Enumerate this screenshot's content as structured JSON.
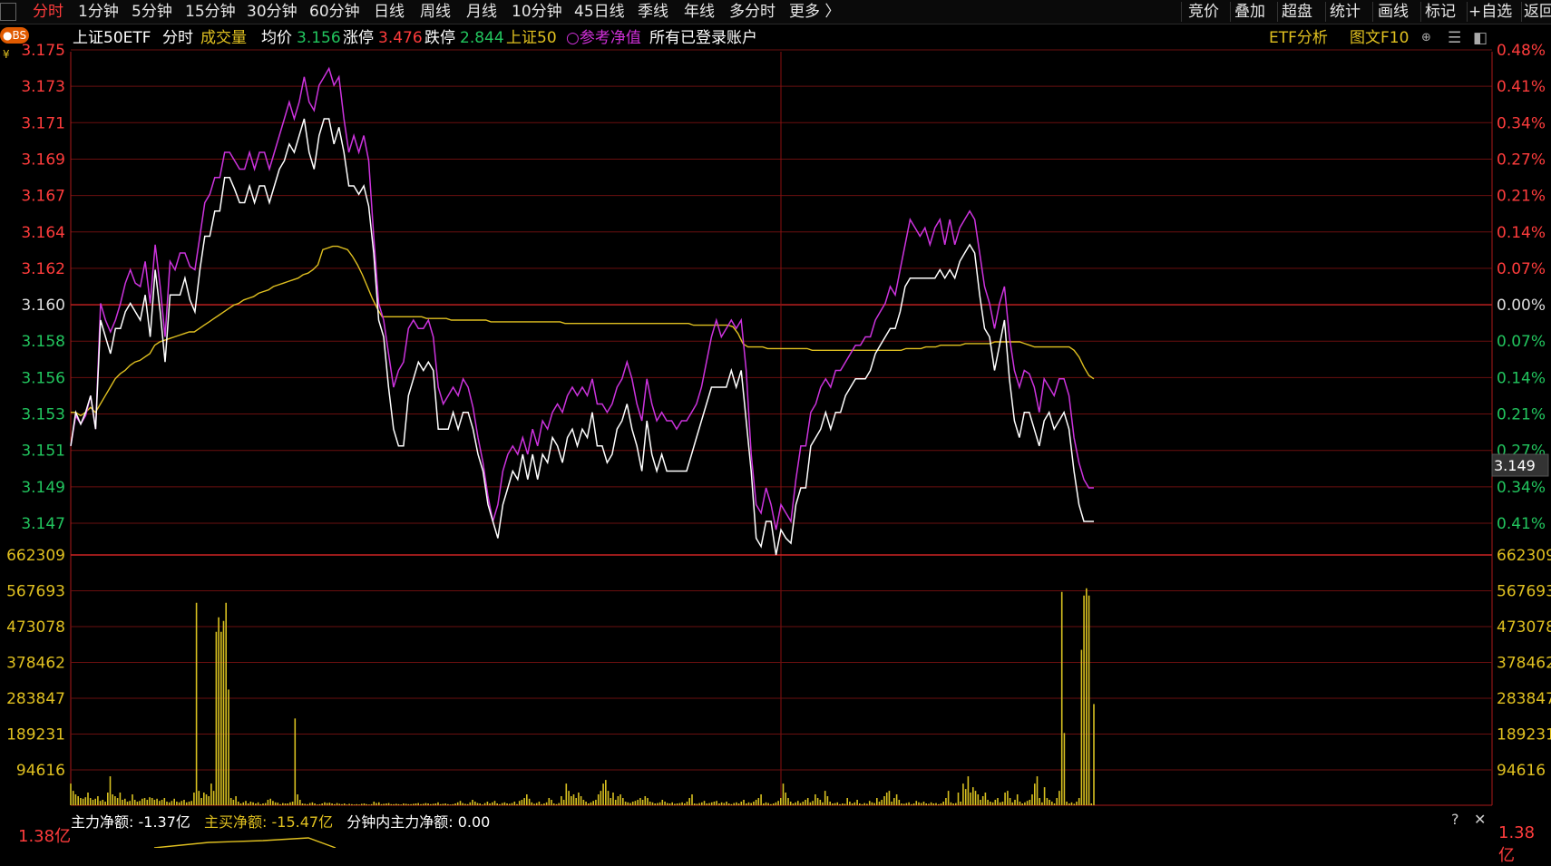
{
  "tabs": [
    {
      "label": "分时",
      "active": true
    },
    {
      "label": "1分钟"
    },
    {
      "label": "5分钟"
    },
    {
      "label": "15分钟"
    },
    {
      "label": "30分钟"
    },
    {
      "label": "60分钟"
    },
    {
      "label": "日线"
    },
    {
      "label": "周线"
    },
    {
      "label": "月线"
    },
    {
      "label": "10分钟"
    },
    {
      "label": "45日线"
    },
    {
      "label": "季线"
    },
    {
      "label": "年线"
    },
    {
      "label": "多分时"
    },
    {
      "label": "更多 〉"
    }
  ],
  "right_tabs": [
    "竞价",
    "叠加",
    "超盘",
    "统计",
    "画线",
    "标记",
    "+自选",
    "返回"
  ],
  "info": {
    "badge": "●BS",
    "symbol": "上证50ETF",
    "mode": "分时",
    "volume_label": "成交量",
    "avg_label": "均价",
    "avg_value": "3.156",
    "limit_up_label": "涨停",
    "limit_up_value": "3.476",
    "limit_down_label": "跌停",
    "limit_down_value": "2.844",
    "index_label": "上证50",
    "nav_label": "○参考净值",
    "account_label": "所有已登录账户",
    "etf_analysis": "ETF分析",
    "f10": "图文F10"
  },
  "price_axis": {
    "left": [
      "3.175",
      "3.173",
      "3.171",
      "3.169",
      "3.167",
      "3.164",
      "3.162",
      "3.160",
      "3.158",
      "3.156",
      "3.153",
      "3.151",
      "3.149",
      "3.147"
    ],
    "right": [
      "0.48%",
      "0.41%",
      "0.34%",
      "0.27%",
      "0.21%",
      "0.14%",
      "0.07%",
      "0.00%",
      "0.07%",
      "0.14%",
      "0.21%",
      "0.27%",
      "0.34%",
      "0.41%"
    ],
    "cursor_value": "3.149"
  },
  "volume_axis": [
    "662309",
    "567693",
    "473078",
    "378462",
    "283847",
    "189231",
    "94616"
  ],
  "footer": {
    "main_net_label": "主力净额:",
    "main_net_value": "-1.37亿",
    "main_buy_label": "主买净额:",
    "main_buy_value": "-15.47亿",
    "minute_net_label": "分钟内主力净额:",
    "minute_net_value": "0.00",
    "bottom_axis_value": "1.38亿",
    "help": "?",
    "close": "✕"
  },
  "chart_data": {
    "type": "line",
    "ylim": [
      3.146,
      3.176
    ],
    "series": [
      {
        "values": [
          3.1525,
          3.1545,
          3.1538,
          3.1545,
          3.1555,
          3.1535,
          3.16,
          3.159,
          3.158,
          3.1595,
          3.1595,
          3.1605,
          3.161,
          3.1605,
          3.16,
          3.1615,
          3.159,
          3.163,
          3.1605,
          3.1575,
          3.1615,
          3.1615,
          3.1615,
          3.1625,
          3.1612,
          3.1605,
          3.163,
          3.165,
          3.165,
          3.1665,
          3.1665,
          3.1685,
          3.1685,
          3.1678,
          3.167,
          3.167,
          3.168,
          3.167,
          3.168,
          3.168,
          3.167,
          3.168,
          3.169,
          3.1695,
          3.1705,
          3.17,
          3.171,
          3.172,
          3.17,
          3.169,
          3.171,
          3.172,
          3.172,
          3.1705,
          3.1715,
          3.17,
          3.168,
          3.168,
          3.1675,
          3.168,
          3.1668,
          3.164,
          3.16,
          3.159,
          3.156,
          3.1535,
          3.1525,
          3.1525,
          3.1555,
          3.1565,
          3.1575,
          3.157,
          3.1575,
          3.157,
          3.1535,
          3.1535,
          3.1535,
          3.1545,
          3.1535,
          3.1545,
          3.1545,
          3.1535,
          3.152,
          3.151,
          3.149,
          3.148,
          3.147,
          3.149,
          3.15,
          3.151,
          3.1505,
          3.152,
          3.1505,
          3.152,
          3.1505,
          3.152,
          3.1515,
          3.153,
          3.1525,
          3.1515,
          3.153,
          3.1535,
          3.1525,
          3.1535,
          3.153,
          3.1545,
          3.1525,
          3.1525,
          3.1515,
          3.152,
          3.1535,
          3.154,
          3.155,
          3.1535,
          3.1525,
          3.151,
          3.154,
          3.152,
          3.151,
          3.152,
          3.151,
          3.151,
          3.151,
          3.151,
          3.151,
          3.152,
          3.153,
          3.154,
          3.155,
          3.156,
          3.156,
          3.156,
          3.156,
          3.157,
          3.156,
          3.157,
          3.154,
          3.151,
          3.147,
          3.1465,
          3.148,
          3.148,
          3.146,
          3.1475,
          3.147,
          3.1467,
          3.149,
          3.15,
          3.15,
          3.1525,
          3.153,
          3.1535,
          3.1545,
          3.1535,
          3.1545,
          3.1545,
          3.1555,
          3.156,
          3.1565,
          3.1565,
          3.1565,
          3.157,
          3.158,
          3.1585,
          3.159,
          3.1595,
          3.1595,
          3.1605,
          3.162,
          3.1625,
          3.1625,
          3.1625,
          3.1625,
          3.1625,
          3.1625,
          3.163,
          3.1625,
          3.163,
          3.1625,
          3.1635,
          3.164,
          3.1645,
          3.164,
          3.1615,
          3.1595,
          3.159,
          3.157,
          3.1585,
          3.16,
          3.1565,
          3.154,
          3.153,
          3.1545,
          3.1545,
          3.1535,
          3.1525,
          3.154,
          3.1545,
          3.1535,
          3.154,
          3.1545,
          3.1535,
          3.151,
          3.149,
          3.148,
          3.148,
          3.148
        ]
      },
      {
        "values": [
          3.1525,
          3.1543,
          3.1538,
          3.1543,
          3.1555,
          3.1535,
          3.161,
          3.16,
          3.1593,
          3.16,
          3.161,
          3.1622,
          3.163,
          3.1622,
          3.162,
          3.1635,
          3.161,
          3.1645,
          3.162,
          3.159,
          3.1635,
          3.163,
          3.164,
          3.164,
          3.1632,
          3.163,
          3.165,
          3.167,
          3.1675,
          3.1685,
          3.1685,
          3.17,
          3.17,
          3.1695,
          3.169,
          3.169,
          3.17,
          3.169,
          3.17,
          3.17,
          3.169,
          3.17,
          3.171,
          3.172,
          3.173,
          3.172,
          3.173,
          3.1745,
          3.173,
          3.1725,
          3.174,
          3.1745,
          3.175,
          3.174,
          3.1745,
          3.172,
          3.17,
          3.171,
          3.17,
          3.171,
          3.1695,
          3.165,
          3.161,
          3.16,
          3.158,
          3.156,
          3.157,
          3.1575,
          3.1595,
          3.16,
          3.1595,
          3.1595,
          3.16,
          3.159,
          3.156,
          3.155,
          3.1555,
          3.156,
          3.1555,
          3.1565,
          3.156,
          3.1548,
          3.153,
          3.1515,
          3.1495,
          3.148,
          3.149,
          3.151,
          3.152,
          3.1525,
          3.152,
          3.153,
          3.152,
          3.1535,
          3.1525,
          3.154,
          3.1535,
          3.1545,
          3.155,
          3.1545,
          3.1555,
          3.156,
          3.1555,
          3.156,
          3.1555,
          3.1565,
          3.155,
          3.155,
          3.1545,
          3.155,
          3.156,
          3.1565,
          3.1575,
          3.1565,
          3.155,
          3.154,
          3.1565,
          3.155,
          3.154,
          3.1545,
          3.154,
          3.154,
          3.1535,
          3.154,
          3.154,
          3.1545,
          3.155,
          3.156,
          3.1575,
          3.159,
          3.16,
          3.159,
          3.1595,
          3.16,
          3.1595,
          3.16,
          3.157,
          3.152,
          3.149,
          3.1485,
          3.15,
          3.149,
          3.1475,
          3.149,
          3.1485,
          3.148,
          3.1505,
          3.1525,
          3.1525,
          3.1545,
          3.155,
          3.156,
          3.1565,
          3.156,
          3.157,
          3.157,
          3.1575,
          3.158,
          3.1585,
          3.1585,
          3.159,
          3.159,
          3.16,
          3.1605,
          3.161,
          3.162,
          3.1615,
          3.163,
          3.1645,
          3.166,
          3.1655,
          3.165,
          3.1655,
          3.1645,
          3.1655,
          3.166,
          3.1645,
          3.166,
          3.1645,
          3.1655,
          3.166,
          3.1665,
          3.166,
          3.164,
          3.162,
          3.161,
          3.1595,
          3.161,
          3.162,
          3.159,
          3.157,
          3.156,
          3.157,
          3.1568,
          3.156,
          3.1545,
          3.1565,
          3.156,
          3.1555,
          3.1565,
          3.1565,
          3.1555,
          3.153,
          3.1515,
          3.1505,
          3.15,
          3.15
        ]
      },
      {
        "values": [
          3.1545,
          3.1545,
          3.1543,
          3.1545,
          3.1548,
          3.1545,
          3.155,
          3.1555,
          3.156,
          3.1565,
          3.1568,
          3.157,
          3.1573,
          3.1575,
          3.1576,
          3.1578,
          3.158,
          3.1585,
          3.1587,
          3.1588,
          3.1589,
          3.159,
          3.1591,
          3.1592,
          3.1593,
          3.1593,
          3.1595,
          3.1597,
          3.1599,
          3.1601,
          3.1603,
          3.1605,
          3.1607,
          3.1609,
          3.161,
          3.1612,
          3.1613,
          3.1614,
          3.1616,
          3.1617,
          3.1618,
          3.162,
          3.1621,
          3.1622,
          3.1623,
          3.1624,
          3.1625,
          3.1627,
          3.1628,
          3.163,
          3.1633,
          3.1642,
          3.1643,
          3.1644,
          3.1644,
          3.1643,
          3.1642,
          3.1638,
          3.1633,
          3.1627,
          3.162,
          3.1613,
          3.1607,
          3.1602,
          3.1602,
          3.1602,
          3.1602,
          3.1602,
          3.1602,
          3.1602,
          3.1602,
          3.1602,
          3.1601,
          3.1601,
          3.1601,
          3.1601,
          3.1601,
          3.16,
          3.16,
          3.16,
          3.16,
          3.16,
          3.16,
          3.16,
          3.16,
          3.1599,
          3.1599,
          3.1599,
          3.1599,
          3.1599,
          3.1599,
          3.1599,
          3.1599,
          3.1599,
          3.1599,
          3.1599,
          3.1599,
          3.1599,
          3.1599,
          3.1599,
          3.1598,
          3.1598,
          3.1598,
          3.1598,
          3.1598,
          3.1598,
          3.1598,
          3.1598,
          3.1598,
          3.1598,
          3.1598,
          3.1598,
          3.1598,
          3.1598,
          3.1598,
          3.1598,
          3.1598,
          3.1598,
          3.1598,
          3.1598,
          3.1598,
          3.1598,
          3.1598,
          3.1598,
          3.1598,
          3.1598,
          3.1597,
          3.1597,
          3.1597,
          3.1597,
          3.1597,
          3.1597,
          3.1597,
          3.1597,
          3.1596,
          3.1592,
          3.1586,
          3.1584,
          3.1584,
          3.1584,
          3.1584,
          3.1583,
          3.1583,
          3.1583,
          3.1583,
          3.1583,
          3.1583,
          3.1583,
          3.1583,
          3.1583,
          3.1582,
          3.1582,
          3.1582,
          3.1582,
          3.1582,
          3.1582,
          3.1582,
          3.1582,
          3.1582,
          3.1582,
          3.1582,
          3.1582,
          3.1582,
          3.1582,
          3.1582,
          3.1582,
          3.1582,
          3.1582,
          3.1582,
          3.1583,
          3.1583,
          3.1583,
          3.1583,
          3.1584,
          3.1584,
          3.1584,
          3.1585,
          3.1585,
          3.1585,
          3.1585,
          3.1585,
          3.1586,
          3.1586,
          3.1586,
          3.1586,
          3.1586,
          3.1586,
          3.1587,
          3.1587,
          3.1587,
          3.1587,
          3.1587,
          3.1587,
          3.1586,
          3.1585,
          3.1584,
          3.1584,
          3.1584,
          3.1584,
          3.1584,
          3.1584,
          3.1584,
          3.1584,
          3.1582,
          3.1578,
          3.1572,
          3.1567,
          3.1565
        ]
      }
    ],
    "volume": {
      "ylim": [
        0,
        662309
      ],
      "values": [
        60000,
        40000,
        30000,
        25000,
        20000,
        18000,
        22000,
        35000,
        20000,
        15000,
        18000,
        25000,
        12000,
        15000,
        10000,
        35000,
        80000,
        30000,
        25000,
        20000,
        35000,
        15000,
        18000,
        10000,
        12000,
        30000,
        15000,
        10000,
        12000,
        18000,
        20000,
        15000,
        22000,
        20000,
        15000,
        18000,
        12000,
        15000,
        20000,
        10000,
        8000,
        12000,
        18000,
        10000,
        8000,
        12000,
        15000,
        8000,
        10000,
        12000,
        35000,
        560000,
        40000,
        20000,
        35000,
        30000,
        25000,
        60000,
        40000,
        480000,
        520000,
        480000,
        510000,
        560000,
        320000,
        20000,
        15000,
        25000,
        10000,
        5000,
        8000,
        12000,
        5000,
        10000,
        8000,
        5000,
        8000,
        3000,
        5000,
        6000,
        15000,
        18000,
        12000,
        8000,
        7000,
        3000,
        6000,
        5000,
        5000,
        8000,
        10000,
        240000,
        30000,
        15000,
        5000,
        4000,
        3000,
        6000,
        8000,
        5000,
        2000,
        3000,
        5000,
        8000,
        6000,
        7000,
        5000,
        3000,
        6000,
        4000,
        3000,
        5000,
        2000,
        4000,
        3000,
        2000,
        3000,
        2000,
        4000,
        5000,
        3000,
        2000,
        3000,
        10000,
        6000,
        8000,
        3000,
        4000,
        5000,
        6000,
        3000,
        3000,
        4000,
        3000,
        2000,
        5000,
        4000,
        3000,
        3000,
        4000,
        5000,
        6000,
        3000,
        4000,
        6000,
        5000,
        3000,
        4000,
        5000,
        8000,
        3000,
        4000,
        5000,
        3000,
        2000,
        3000,
        5000,
        8000,
        12000,
        6000,
        4000,
        3000,
        8000,
        15000,
        10000,
        6000,
        5000,
        2000,
        6000,
        10000,
        5000,
        8000,
        12000,
        5000,
        3000,
        6000,
        8000,
        5000,
        4000,
        6000,
        10000,
        3000,
        12000,
        15000,
        20000,
        30000,
        18000,
        8000,
        4000,
        6000,
        10000,
        3000,
        5000,
        8000,
        20000,
        15000,
        5000,
        3000,
        6000,
        25000,
        15000,
        60000,
        40000,
        25000,
        30000,
        20000,
        35000,
        25000,
        15000,
        10000,
        5000,
        8000,
        12000,
        15000,
        30000,
        40000,
        60000,
        70000,
        40000,
        20000,
        35000,
        15000,
        25000,
        30000,
        20000,
        10000,
        8000,
        6000,
        10000,
        12000,
        15000,
        20000,
        15000,
        25000,
        20000,
        10000,
        8000,
        5000,
        6000,
        8000,
        15000,
        10000,
        6000,
        5000,
        8000,
        4000,
        5000,
        6000,
        8000,
        5000,
        10000,
        20000,
        30000,
        5000,
        4000,
        6000,
        8000,
        12000,
        5000,
        6000,
        8000,
        10000,
        12000,
        5000,
        8000,
        6000,
        10000,
        5000,
        3000,
        6000,
        8000,
        5000,
        10000,
        15000,
        5000,
        8000,
        6000,
        10000,
        15000,
        20000,
        30000,
        5000,
        8000,
        6000,
        3000,
        5000,
        8000,
        12000,
        20000,
        60000,
        35000,
        20000,
        10000,
        5000,
        8000,
        12000,
        6000,
        10000,
        15000,
        20000,
        8000,
        12000,
        30000,
        20000,
        15000,
        8000,
        40000,
        25000,
        10000,
        5000,
        6000,
        8000,
        3000,
        5000,
        4000,
        20000,
        10000,
        5000,
        8000,
        15000,
        5000,
        3000,
        6000,
        4000,
        12000,
        8000,
        6000,
        20000,
        10000,
        15000,
        25000,
        35000,
        40000,
        10000,
        20000,
        30000,
        15000,
        5000,
        4000,
        6000,
        8000,
        3000,
        5000,
        12000,
        8000,
        6000,
        10000,
        5000,
        4000,
        8000,
        5000,
        6000,
        3000,
        5000,
        10000,
        20000,
        40000,
        8000,
        5000,
        6000,
        35000,
        10000,
        60000,
        45000,
        80000,
        35000,
        50000,
        40000,
        30000,
        15000,
        25000,
        35000,
        15000,
        10000,
        8000,
        15000,
        20000,
        8000,
        10000,
        35000,
        40000,
        20000,
        8000,
        15000,
        30000,
        10000,
        5000,
        8000,
        12000,
        15000,
        30000,
        60000,
        80000,
        20000,
        8000,
        50000,
        20000,
        15000,
        10000,
        5000,
        20000,
        40000,
        590000,
        200000,
        10000,
        5000,
        8000,
        4000,
        10000,
        20000,
        430000,
        580000,
        600000,
        580000,
        5000,
        280000
      ]
    }
  }
}
